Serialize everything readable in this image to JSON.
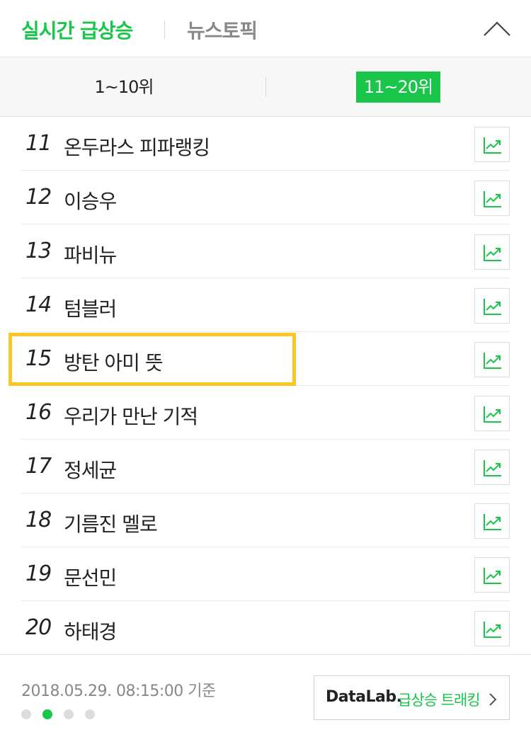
{
  "header": {
    "active_tab": "실시간 급상승",
    "inactive_tab": "뉴스토픽",
    "collapse_icon": "chevron-up-icon"
  },
  "range_tabs": {
    "first": "1~10위",
    "second": "11~20위",
    "selected": "11~20위"
  },
  "colors": {
    "accent": "#19c64a",
    "highlight": "#f9c623",
    "muted": "#888888"
  },
  "keywords": [
    {
      "rank": "11",
      "keyword": "온두라스 피파랭킹"
    },
    {
      "rank": "12",
      "keyword": "이승우"
    },
    {
      "rank": "13",
      "keyword": "파비뉴"
    },
    {
      "rank": "14",
      "keyword": "텀블러"
    },
    {
      "rank": "15",
      "keyword": "방탄 아미 뜻",
      "highlighted": true
    },
    {
      "rank": "16",
      "keyword": "우리가 만난 기적"
    },
    {
      "rank": "17",
      "keyword": "정세균"
    },
    {
      "rank": "18",
      "keyword": "기름진 멜로"
    },
    {
      "rank": "19",
      "keyword": "문선민"
    },
    {
      "rank": "20",
      "keyword": "하태경"
    }
  ],
  "trend_icon": "trend-chart-icon",
  "footer": {
    "timestamp": "2018.05.29. 08:15:00 기준",
    "pagination": {
      "total": 4,
      "active": 2
    },
    "datalab_brand": "DataLab.",
    "datalab_text": "급상승 트래킹"
  }
}
